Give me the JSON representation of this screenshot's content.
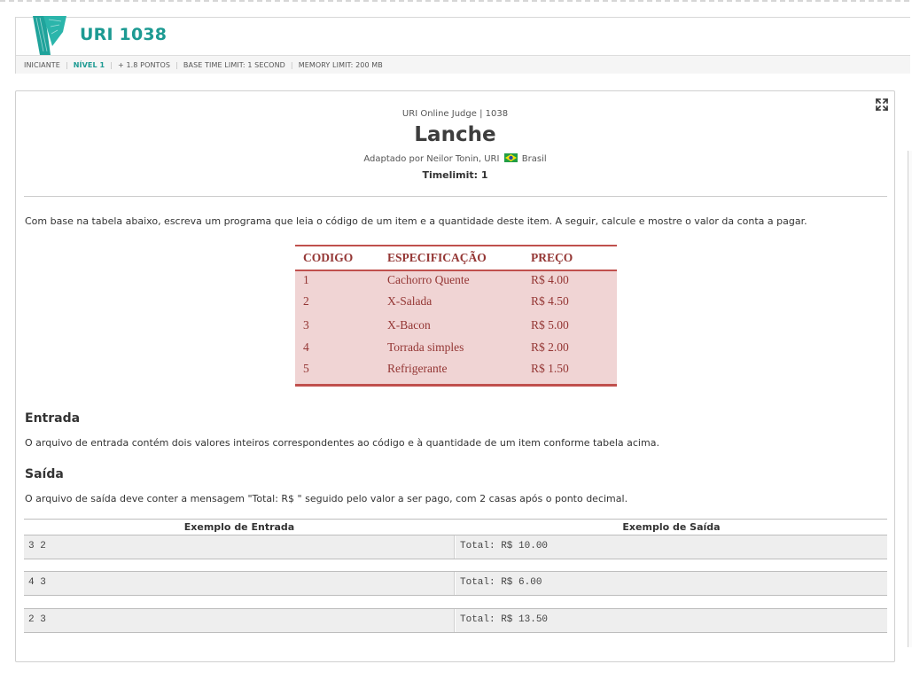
{
  "header": {
    "problem_code": "URI 1038",
    "meta": {
      "category": "INICIANTE",
      "level": "NÍVEL 1",
      "points": "+ 1.8 PONTOS",
      "time_limit": "BASE TIME LIMIT: 1 SECOND",
      "memory_limit": "MEMORY LIMIT: 200 MB"
    }
  },
  "problem": {
    "judge_line": "URI Online Judge | 1038",
    "title": "Lanche",
    "author_prefix": "Adaptado por Neilor Tonin, URI",
    "author_country": "Brasil",
    "timelimit": "Timelimit: 1",
    "description": "Com base na tabela abaixo, escreva um programa que leia o código de um item e a quantidade deste item. A seguir, calcule e mostre o valor da conta a pagar."
  },
  "price_table": {
    "headers": [
      "CODIGO",
      "ESPECIFICAÇÃO",
      "PREÇO"
    ],
    "rows": [
      [
        "1",
        "Cachorro Quente",
        "R$ 4.00"
      ],
      [
        "2",
        "X-Salada",
        "R$ 4.50"
      ],
      [
        "3",
        "X-Bacon",
        "R$ 5.00"
      ],
      [
        "4",
        "Torrada simples",
        "R$ 2.00"
      ],
      [
        "5",
        "Refrigerante",
        "R$ 1.50"
      ]
    ]
  },
  "input_section": {
    "heading": "Entrada",
    "text": "O arquivo de entrada contém dois valores inteiros correspondentes ao código e à quantidade de um item conforme tabela acima."
  },
  "output_section": {
    "heading": "Saída",
    "text": "O arquivo de saída deve conter a mensagem \"Total: R$ \" seguido pelo valor a ser pago, com 2 casas após o ponto decimal."
  },
  "examples": {
    "input_header": "Exemplo de Entrada",
    "output_header": "Exemplo de Saída",
    "rows": [
      {
        "input": "3 2",
        "output": "Total: R$ 10.00"
      },
      {
        "input": "4 3",
        "output": "Total: R$ 6.00"
      },
      {
        "input": "2 3",
        "output": "Total: R$ 13.50"
      }
    ]
  },
  "icons": {
    "logo": "uri-logo-icon",
    "expand": "fullscreen-expand-icon",
    "flag": "brazil-flag-icon"
  },
  "colors": {
    "accent": "#1c9a92",
    "table_border": "#c0504d",
    "table_fill": "#f0d4d4",
    "table_text": "#943634"
  }
}
